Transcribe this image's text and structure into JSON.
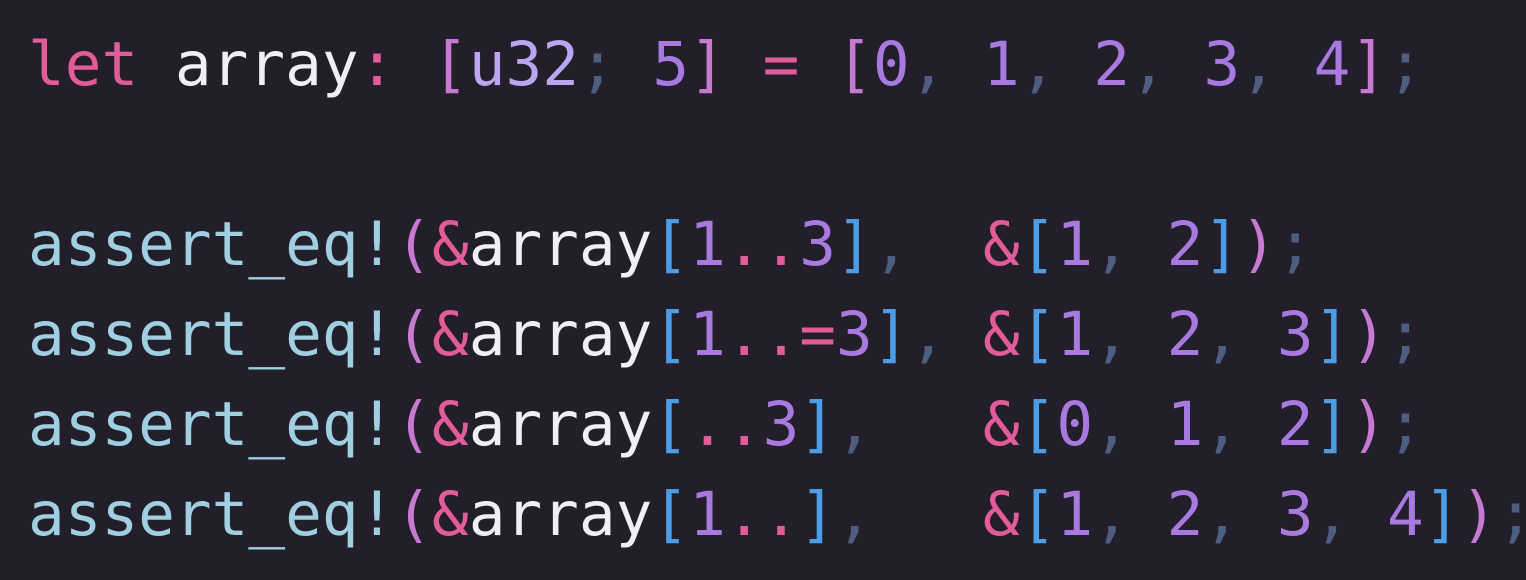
{
  "code": {
    "language": "rust",
    "lines": [
      [
        {
          "text": "let",
          "kind": "kw"
        },
        {
          "text": " ",
          "kind": "id"
        },
        {
          "text": "array",
          "kind": "id"
        },
        {
          "text": ":",
          "kind": "col"
        },
        {
          "text": " ",
          "kind": "id"
        },
        {
          "text": "[",
          "kind": "br1"
        },
        {
          "text": "u32",
          "kind": "ty"
        },
        {
          "text": ";",
          "kind": "pun"
        },
        {
          "text": " ",
          "kind": "id"
        },
        {
          "text": "5",
          "kind": "num"
        },
        {
          "text": "]",
          "kind": "br1"
        },
        {
          "text": " ",
          "kind": "id"
        },
        {
          "text": "=",
          "kind": "col"
        },
        {
          "text": " ",
          "kind": "id"
        },
        {
          "text": "[",
          "kind": "br1"
        },
        {
          "text": "0",
          "kind": "num"
        },
        {
          "text": ",",
          "kind": "pun"
        },
        {
          "text": " ",
          "kind": "id"
        },
        {
          "text": "1",
          "kind": "num"
        },
        {
          "text": ",",
          "kind": "pun"
        },
        {
          "text": " ",
          "kind": "id"
        },
        {
          "text": "2",
          "kind": "num"
        },
        {
          "text": ",",
          "kind": "pun"
        },
        {
          "text": " ",
          "kind": "id"
        },
        {
          "text": "3",
          "kind": "num"
        },
        {
          "text": ",",
          "kind": "pun"
        },
        {
          "text": " ",
          "kind": "id"
        },
        {
          "text": "4",
          "kind": "num"
        },
        {
          "text": "]",
          "kind": "br1"
        },
        {
          "text": ";",
          "kind": "pun"
        }
      ],
      [],
      [
        {
          "text": "assert_eq!",
          "kind": "mac"
        },
        {
          "text": "(",
          "kind": "br1"
        },
        {
          "text": "&",
          "kind": "col"
        },
        {
          "text": "array",
          "kind": "id"
        },
        {
          "text": "[",
          "kind": "br2"
        },
        {
          "text": "1",
          "kind": "num"
        },
        {
          "text": "..",
          "kind": "rng"
        },
        {
          "text": "3",
          "kind": "num"
        },
        {
          "text": "]",
          "kind": "br2"
        },
        {
          "text": ",",
          "kind": "pun"
        },
        {
          "text": "  ",
          "kind": "id"
        },
        {
          "text": "&",
          "kind": "col"
        },
        {
          "text": "[",
          "kind": "br2"
        },
        {
          "text": "1",
          "kind": "num"
        },
        {
          "text": ",",
          "kind": "pun"
        },
        {
          "text": " ",
          "kind": "id"
        },
        {
          "text": "2",
          "kind": "num"
        },
        {
          "text": "]",
          "kind": "br2"
        },
        {
          "text": ")",
          "kind": "br1"
        },
        {
          "text": ";",
          "kind": "pun"
        }
      ],
      [
        {
          "text": "assert_eq!",
          "kind": "mac"
        },
        {
          "text": "(",
          "kind": "br1"
        },
        {
          "text": "&",
          "kind": "col"
        },
        {
          "text": "array",
          "kind": "id"
        },
        {
          "text": "[",
          "kind": "br2"
        },
        {
          "text": "1",
          "kind": "num"
        },
        {
          "text": "..=",
          "kind": "rng"
        },
        {
          "text": "3",
          "kind": "num"
        },
        {
          "text": "]",
          "kind": "br2"
        },
        {
          "text": ",",
          "kind": "pun"
        },
        {
          "text": " ",
          "kind": "id"
        },
        {
          "text": "&",
          "kind": "col"
        },
        {
          "text": "[",
          "kind": "br2"
        },
        {
          "text": "1",
          "kind": "num"
        },
        {
          "text": ",",
          "kind": "pun"
        },
        {
          "text": " ",
          "kind": "id"
        },
        {
          "text": "2",
          "kind": "num"
        },
        {
          "text": ",",
          "kind": "pun"
        },
        {
          "text": " ",
          "kind": "id"
        },
        {
          "text": "3",
          "kind": "num"
        },
        {
          "text": "]",
          "kind": "br2"
        },
        {
          "text": ")",
          "kind": "br1"
        },
        {
          "text": ";",
          "kind": "pun"
        }
      ],
      [
        {
          "text": "assert_eq!",
          "kind": "mac"
        },
        {
          "text": "(",
          "kind": "br1"
        },
        {
          "text": "&",
          "kind": "col"
        },
        {
          "text": "array",
          "kind": "id"
        },
        {
          "text": "[",
          "kind": "br2"
        },
        {
          "text": "..",
          "kind": "rng"
        },
        {
          "text": "3",
          "kind": "num"
        },
        {
          "text": "]",
          "kind": "br2"
        },
        {
          "text": ",",
          "kind": "pun"
        },
        {
          "text": "   ",
          "kind": "id"
        },
        {
          "text": "&",
          "kind": "col"
        },
        {
          "text": "[",
          "kind": "br2"
        },
        {
          "text": "0",
          "kind": "num"
        },
        {
          "text": ",",
          "kind": "pun"
        },
        {
          "text": " ",
          "kind": "id"
        },
        {
          "text": "1",
          "kind": "num"
        },
        {
          "text": ",",
          "kind": "pun"
        },
        {
          "text": " ",
          "kind": "id"
        },
        {
          "text": "2",
          "kind": "num"
        },
        {
          "text": "]",
          "kind": "br2"
        },
        {
          "text": ")",
          "kind": "br1"
        },
        {
          "text": ";",
          "kind": "pun"
        }
      ],
      [
        {
          "text": "assert_eq!",
          "kind": "mac"
        },
        {
          "text": "(",
          "kind": "br1"
        },
        {
          "text": "&",
          "kind": "col"
        },
        {
          "text": "array",
          "kind": "id"
        },
        {
          "text": "[",
          "kind": "br2"
        },
        {
          "text": "1",
          "kind": "num"
        },
        {
          "text": "..",
          "kind": "rng"
        },
        {
          "text": "]",
          "kind": "br2"
        },
        {
          "text": ",",
          "kind": "pun"
        },
        {
          "text": "   ",
          "kind": "id"
        },
        {
          "text": "&",
          "kind": "col"
        },
        {
          "text": "[",
          "kind": "br2"
        },
        {
          "text": "1",
          "kind": "num"
        },
        {
          "text": ",",
          "kind": "pun"
        },
        {
          "text": " ",
          "kind": "id"
        },
        {
          "text": "2",
          "kind": "num"
        },
        {
          "text": ",",
          "kind": "pun"
        },
        {
          "text": " ",
          "kind": "id"
        },
        {
          "text": "3",
          "kind": "num"
        },
        {
          "text": ",",
          "kind": "pun"
        },
        {
          "text": " ",
          "kind": "id"
        },
        {
          "text": "4",
          "kind": "num"
        },
        {
          "text": "]",
          "kind": "br2"
        },
        {
          "text": ")",
          "kind": "br1"
        },
        {
          "text": ";",
          "kind": "pun"
        }
      ]
    ]
  },
  "colors": {
    "background": "#221f2b",
    "keyword": "#e25c99",
    "identifier": "#f0eef8",
    "macro": "#9fcfe0",
    "bracket_outer": "#c77ad0",
    "bracket_inner": "#4c9ce6",
    "type": "#b9a6ee",
    "number": "#a87ae0",
    "punctuation": "#4d5e80"
  }
}
